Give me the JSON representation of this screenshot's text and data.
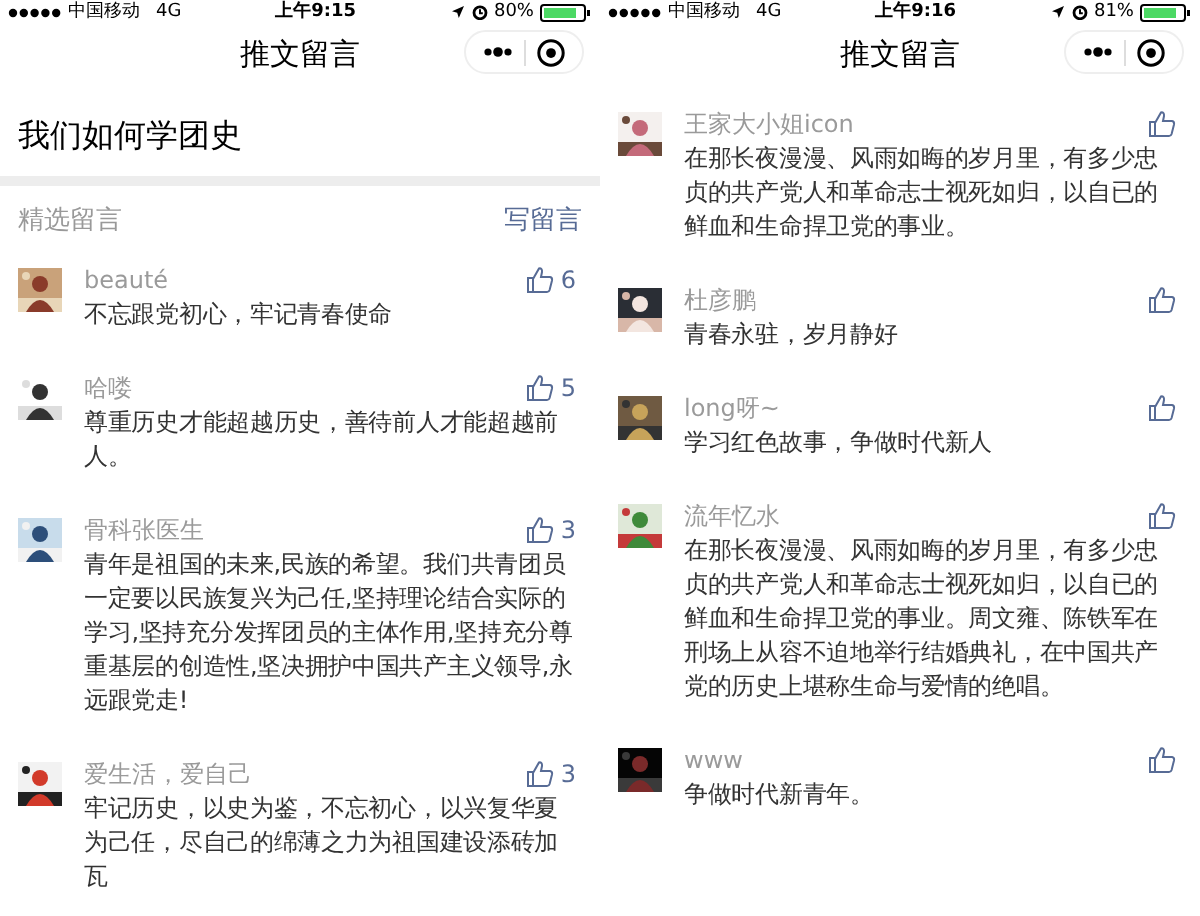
{
  "screens": [
    {
      "status_bar": {
        "carrier": "中国移动",
        "network": "4G",
        "time": "上午9:15",
        "battery": "80%"
      },
      "nav_title": "推文留言",
      "article_title": "我们如何学团史",
      "section": {
        "label": "精选留言",
        "action": "写留言"
      },
      "comments": [
        {
          "name": "beauté",
          "text": "不忘跟党初心，牢记青春使命",
          "likes": "6"
        },
        {
          "name": "哈喽",
          "text": "尊重历史才能超越历史，善待前人才能超越前人。",
          "likes": "5"
        },
        {
          "name": "骨科张医生",
          "text": "青年是祖国的未来,民族的希望。我们共青团员一定要以民族复兴为己任,坚持理论结合实际的学习,坚持充分发挥团员的主体作用,坚持充分尊重基层的创造性,坚决拥护中国共产主义领导,永远跟党走!",
          "likes": "3"
        },
        {
          "name": "爱生活，爱自己",
          "text": "牢记历史，以史为鉴，不忘初心，以兴复华夏为己任，尽自己的绵薄之力为祖国建设添砖加瓦",
          "likes": "3"
        }
      ]
    },
    {
      "status_bar": {
        "carrier": "中国移动",
        "network": "4G",
        "time": "上午9:16",
        "battery": "81%"
      },
      "nav_title": "推文留言",
      "comments": [
        {
          "name": "王家大小姐icon",
          "text": "在那长夜漫漫、风雨如晦的岁月里，有多少忠贞的共产党人和革命志士视死如归，以自已的鲜血和生命捍卫党的事业。"
        },
        {
          "name": "杜彦鹏",
          "text": "青春永驻，岁月静好"
        },
        {
          "name": "long呀~",
          "text": "学习红色故事，争做时代新人"
        },
        {
          "name": "流年忆水",
          "text": " 在那长夜漫漫、风雨如晦的岁月里，有多少忠贞的共产党人和革命志士视死如归，以自已的鲜血和生命捍卫党的事业。周文雍、陈铁军在刑场上从容不迫地举行结婚典礼，在中国共产党的历史上堪称生命与爱情的绝唱。"
        },
        {
          "name": "www",
          "text": "争做时代新青年。"
        }
      ]
    }
  ]
}
